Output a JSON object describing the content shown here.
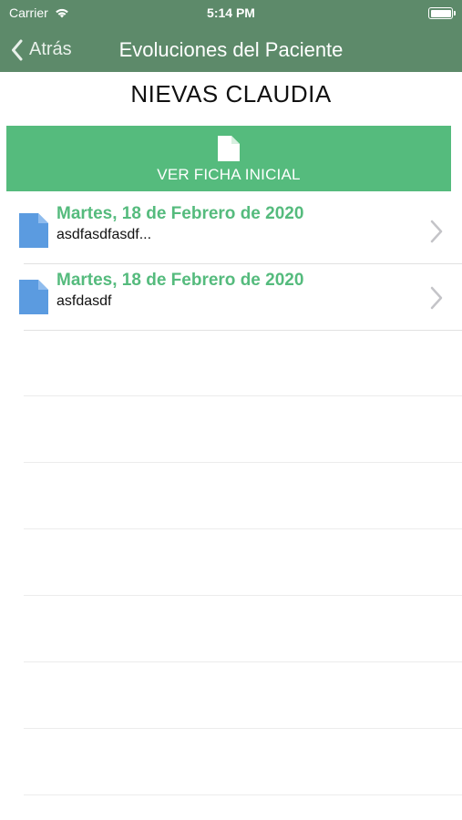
{
  "status_bar": {
    "carrier": "Carrier",
    "time": "5:14 PM",
    "icons": [
      "wifi-icon",
      "battery-icon"
    ]
  },
  "nav": {
    "back_label": "Atrás",
    "title": "Evoluciones del Paciente"
  },
  "patient": {
    "name": "NIEVAS CLAUDIA"
  },
  "ficha_button": {
    "label": "VER FICHA INICIAL",
    "icon": "document-icon"
  },
  "evoluciones": [
    {
      "date": "Martes, 18 de Febrero de 2020",
      "note": "asdfasdfasdf..."
    },
    {
      "date": "Martes, 18 de Febrero de 2020",
      "note": "asfdasdf"
    }
  ],
  "colors": {
    "nav_background": "#5d8a6a",
    "accent_green": "#55bb7d",
    "file_icon_blue": "#5b9be0",
    "chevron_gray": "#c4c4c8"
  }
}
